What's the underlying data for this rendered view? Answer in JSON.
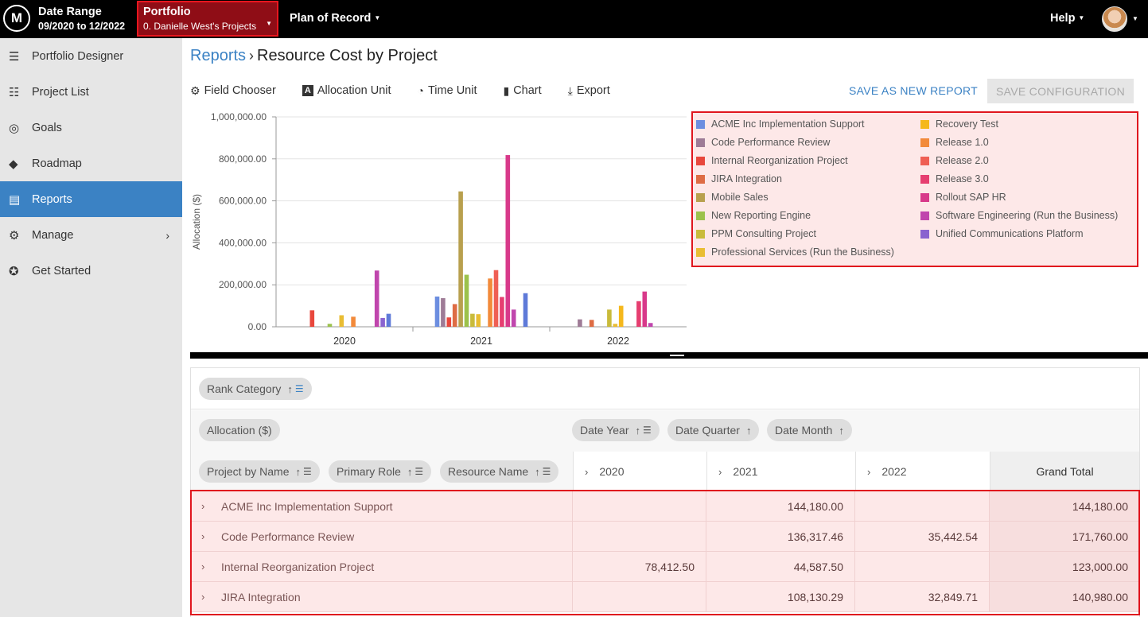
{
  "header": {
    "date_range_title": "Date Range",
    "date_range_value": "09/2020 to 12/2022",
    "portfolio_title": "Portfolio",
    "portfolio_value": "0. Danielle West's Projects",
    "plan": "Plan of Record",
    "help": "Help"
  },
  "sidebar": {
    "items": [
      {
        "label": "Portfolio Designer",
        "icon": "portfolio-designer-icon"
      },
      {
        "label": "Project List",
        "icon": "list-icon"
      },
      {
        "label": "Goals",
        "icon": "target-icon"
      },
      {
        "label": "Roadmap",
        "icon": "roadmap-icon"
      },
      {
        "label": "Reports",
        "icon": "document-icon",
        "active": true
      },
      {
        "label": "Manage",
        "icon": "gear-icon"
      },
      {
        "label": "Get Started",
        "icon": "compass-icon"
      }
    ]
  },
  "breadcrumb": {
    "parent": "Reports",
    "current": "Resource Cost by Project"
  },
  "toolbar": {
    "field_chooser": "Field Chooser",
    "allocation_unit": "Allocation Unit",
    "time_unit": "Time Unit",
    "chart": "Chart",
    "export": "Export",
    "save_new": "SAVE AS NEW REPORT",
    "save_config": "SAVE CONFIGURATION"
  },
  "colors": {
    "accent": "#3b82c4",
    "highlight": "#e0161e"
  },
  "chart_data": {
    "type": "bar",
    "categories": [
      "2020",
      "2021",
      "2022"
    ],
    "ylabel": "Allocation ($)",
    "ylim": [
      0,
      1000000
    ],
    "yticks": [
      "0.00",
      "200,000.00",
      "400,000.00",
      "600,000.00",
      "800,000.00",
      "1,000,000.00"
    ],
    "legend_position": "right",
    "series": [
      {
        "name": "ACME Inc Implementation Support",
        "color": "#6c8ee0",
        "values": [
          0,
          144180,
          0
        ]
      },
      {
        "name": "Code Performance Review",
        "color": "#9e7b96",
        "values": [
          0,
          136317,
          35443
        ]
      },
      {
        "name": "Internal Reorganization Project",
        "color": "#e8473c",
        "values": [
          78413,
          44588,
          0
        ]
      },
      {
        "name": "JIRA Integration",
        "color": "#de6c44",
        "values": [
          0,
          108130,
          32850
        ]
      },
      {
        "name": "Mobile Sales",
        "color": "#b8a04e",
        "values": [
          0,
          645000,
          0
        ]
      },
      {
        "name": "New Reporting Engine",
        "color": "#9cc24c",
        "values": [
          14000,
          248000,
          0
        ]
      },
      {
        "name": "PPM Consulting Project",
        "color": "#c9bb3b",
        "values": [
          0,
          62000,
          82000
        ]
      },
      {
        "name": "Professional Services (Run the Business)",
        "color": "#e9bd33",
        "values": [
          55000,
          60000,
          14000
        ]
      },
      {
        "name": "Recovery Test",
        "color": "#f5b81c",
        "values": [
          0,
          0,
          100000
        ]
      },
      {
        "name": "Release 1.0",
        "color": "#f28a3a",
        "values": [
          48000,
          230000,
          0
        ]
      },
      {
        "name": "Release 2.0",
        "color": "#ef5f54",
        "values": [
          0,
          270000,
          0
        ]
      },
      {
        "name": "Release 3.0",
        "color": "#e63e70",
        "values": [
          0,
          142000,
          122000
        ]
      },
      {
        "name": "Rollout SAP HR",
        "color": "#d8398a",
        "values": [
          0,
          818000,
          168000
        ]
      },
      {
        "name": "Software Engineering (Run the Business)",
        "color": "#c046ad",
        "values": [
          268000,
          82000,
          18000
        ]
      },
      {
        "name": "Unified Communications Platform",
        "color": "#8a63cf",
        "values": [
          42000,
          0,
          0
        ]
      },
      {
        "name": "",
        "color": "#5e7ad8",
        "values": [
          62000,
          160000,
          0
        ]
      }
    ]
  },
  "pivot": {
    "filter_chip": "Rank Category",
    "value_chip": "Allocation ($)",
    "col_chips": [
      "Date Year",
      "Date Quarter",
      "Date Month"
    ],
    "row_chips": [
      "Project by Name",
      "Primary Role",
      "Resource Name"
    ],
    "columns": [
      "2020",
      "2021",
      "2022",
      "Grand Total"
    ],
    "rows": [
      {
        "name": "ACME Inc Implementation Support",
        "c2020": "",
        "c2021": "144,180.00",
        "c2022": "",
        "total": "144,180.00"
      },
      {
        "name": "Code Performance Review",
        "c2020": "",
        "c2021": "136,317.46",
        "c2022": "35,442.54",
        "total": "171,760.00"
      },
      {
        "name": "Internal Reorganization Project",
        "c2020": "78,412.50",
        "c2021": "44,587.50",
        "c2022": "",
        "total": "123,000.00"
      },
      {
        "name": "JIRA Integration",
        "c2020": "",
        "c2021": "108,130.29",
        "c2022": "32,849.71",
        "total": "140,980.00"
      }
    ]
  }
}
